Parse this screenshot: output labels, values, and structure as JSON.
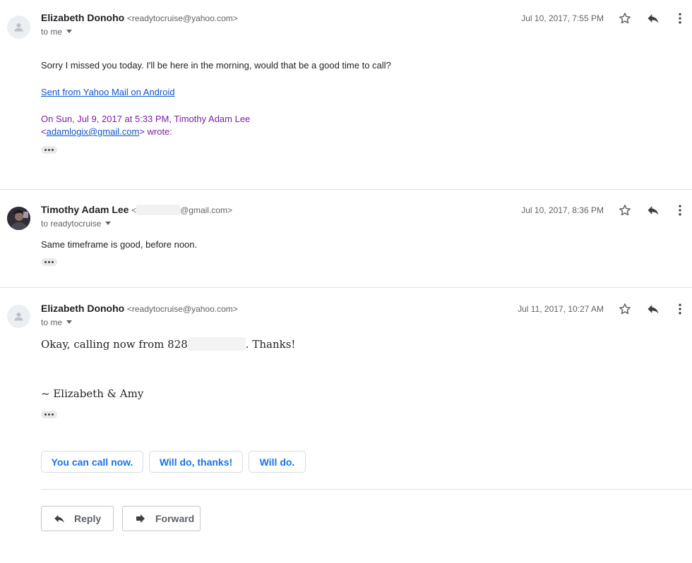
{
  "messages": [
    {
      "sender_name": "Elizabeth Donoho",
      "sender_email": "<readytocruise@yahoo.com>",
      "recipient": "to me",
      "date": "Jul 10, 2017, 7:55 PM",
      "body": "Sorry I missed you today. I'll be here in the morning, would that be a good time to call?",
      "signature_link": "Sent from Yahoo Mail on Android",
      "quote_line1": "On Sun, Jul 9, 2017 at 5:33 PM, Timothy Adam Lee",
      "quote_open": "<",
      "quote_email": "adamlogix@gmail.com",
      "quote_close": "> wrote:"
    },
    {
      "sender_name": "Timothy Adam Lee",
      "sender_email_prefix": "<",
      "sender_email_suffix": "@gmail.com>",
      "recipient": "to readytocruise",
      "date": "Jul 10, 2017, 8:36 PM",
      "body": "Same timeframe is good, before noon."
    },
    {
      "sender_name": "Elizabeth Donoho",
      "sender_email": "<readytocruise@yahoo.com>",
      "recipient": "to me",
      "date": "Jul 11, 2017, 10:27 AM",
      "body_prefix": "Okay, calling now from 828",
      "body_suffix": ". Thanks!",
      "signoff": "~ Elizabeth & Amy"
    }
  ],
  "smart_replies": [
    "You can call now.",
    "Will do, thanks!",
    "Will do."
  ],
  "actions": {
    "reply": "Reply",
    "forward": "Forward"
  },
  "colors": {
    "link": "#1155cc",
    "quote": "#7b1fa2",
    "chip_text": "#1a73e8"
  },
  "icons": [
    "person-icon",
    "star-icon",
    "reply-icon",
    "more-vert-icon",
    "forward-icon",
    "ellipsis-icon"
  ]
}
